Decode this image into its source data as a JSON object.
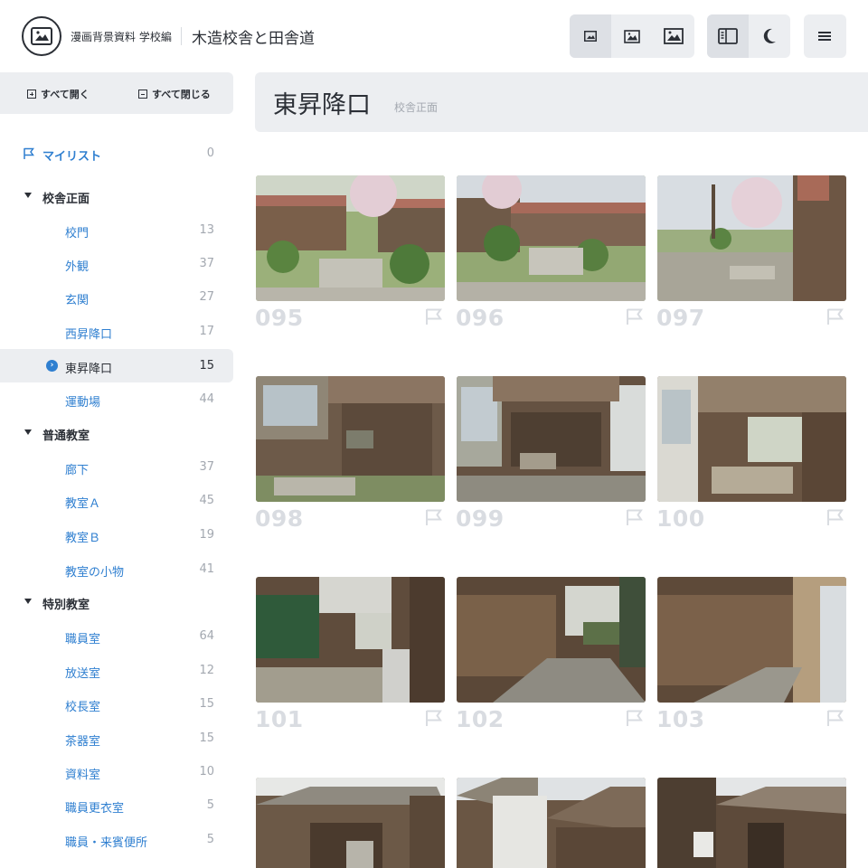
{
  "header": {
    "subtitle": "漫画背景資料 学校編",
    "title": "木造校舎と田舎道",
    "icons": [
      "image-small-icon",
      "image-medium-icon",
      "image-large-icon",
      "sidebar-icon",
      "moon-icon",
      "menu-icon"
    ]
  },
  "sidebar": {
    "expand_all": "すべて開く",
    "collapse_all": "すべて閉じる",
    "mylist": {
      "label": "マイリスト",
      "count": "0"
    },
    "categories": [
      {
        "label": "校舎正面",
        "items": [
          {
            "label": "校門",
            "count": "13"
          },
          {
            "label": "外観",
            "count": "37"
          },
          {
            "label": "玄関",
            "count": "27"
          },
          {
            "label": "西昇降口",
            "count": "17"
          },
          {
            "label": "東昇降口",
            "count": "15"
          },
          {
            "label": "運動場",
            "count": "44"
          }
        ]
      },
      {
        "label": "普通教室",
        "items": [
          {
            "label": "廊下",
            "count": "37"
          },
          {
            "label": "教室Ａ",
            "count": "45"
          },
          {
            "label": "教室Ｂ",
            "count": "19"
          },
          {
            "label": "教室の小物",
            "count": "41"
          }
        ]
      },
      {
        "label": "特別教室",
        "items": [
          {
            "label": "職員室",
            "count": "64"
          },
          {
            "label": "放送室",
            "count": "12"
          },
          {
            "label": "校長室",
            "count": "15"
          },
          {
            "label": "茶器室",
            "count": "15"
          },
          {
            "label": "資料室",
            "count": "10"
          },
          {
            "label": "職員更衣室",
            "count": "5"
          },
          {
            "label": "職員・来賓便所",
            "count": "5"
          }
        ]
      }
    ]
  },
  "main": {
    "title": "東昇降口",
    "subtitle": "校舎正面",
    "photos": [
      {
        "num": "095"
      },
      {
        "num": "096"
      },
      {
        "num": "097"
      },
      {
        "num": "098"
      },
      {
        "num": "099"
      },
      {
        "num": "100"
      },
      {
        "num": "101"
      },
      {
        "num": "102"
      },
      {
        "num": "103"
      },
      {
        "num": ""
      },
      {
        "num": ""
      },
      {
        "num": ""
      }
    ]
  },
  "colors": {
    "accent": "#2f7fd0",
    "panel": "#eceef1",
    "muted": "#a3a8b0",
    "number": "#d9dce1"
  }
}
